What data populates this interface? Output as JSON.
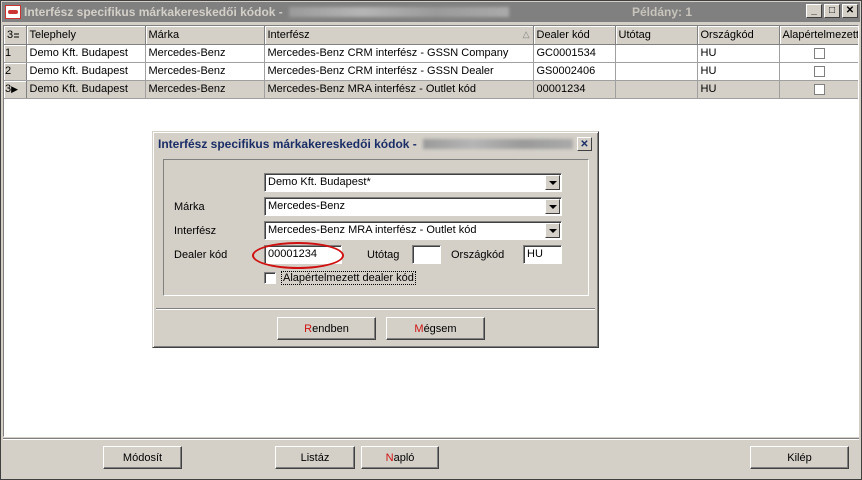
{
  "window": {
    "title": "Interfész specifikus márkakereskedői kódok -",
    "count_label": "Példány: 1",
    "controls": {
      "minimize": "_",
      "maximize": "□",
      "close": "✕"
    }
  },
  "grid": {
    "corner_label": "3",
    "columns": [
      "Telephely",
      "Márka",
      "Interfész",
      "Dealer kód",
      "Utótag",
      "Országkód",
      "Alapértelmezett d"
    ],
    "rows": [
      {
        "num": "1",
        "telephely": "Demo Kft. Budapest",
        "marka": "Mercedes-Benz",
        "interfesz": "Mercedes-Benz CRM interfész - GSSN Company",
        "dealer_kod": "GC0001534",
        "utotag": "",
        "orszagkod": "HU",
        "alapertelmezett": false
      },
      {
        "num": "2",
        "telephely": "Demo Kft. Budapest",
        "marka": "Mercedes-Benz",
        "interfesz": "Mercedes-Benz CRM interfész - GSSN Dealer",
        "dealer_kod": "GS0002406",
        "utotag": "",
        "orszagkod": "HU",
        "alapertelmezett": false
      },
      {
        "num": "3",
        "telephely": "Demo Kft. Budapest",
        "marka": "Mercedes-Benz",
        "interfesz": "Mercedes-Benz MRA interfész - Outlet kód",
        "dealer_kod": "00001234",
        "utotag": "",
        "orszagkod": "HU",
        "alapertelmezett": false,
        "selected": true
      }
    ]
  },
  "dialog": {
    "title": "Interfész specifikus márkakereskedői kódok -",
    "close": "✕",
    "telephely_value": "Demo Kft. Budapest*",
    "marka_label": "Márka",
    "marka_value": "Mercedes-Benz",
    "interfesz_label": "Interfész",
    "interfesz_value": "Mercedes-Benz MRA interfész - Outlet kód",
    "dealer_kod_label": "Dealer kód",
    "dealer_kod_value": "00001234",
    "utotag_label": "Utótag",
    "utotag_value": "",
    "orszagkod_label": "Országkód",
    "orszagkod_value": "HU",
    "default_checkbox_label": "Alapértelmezett dealer kód",
    "ok_accel": "R",
    "ok_rest": "endben",
    "cancel_accel": "M",
    "cancel_rest": "égsem"
  },
  "footer": {
    "modify_label": "Módosít",
    "list_label": "Listáz",
    "log_accel": "N",
    "log_rest": "apló",
    "exit_label": "Kilép"
  },
  "colors": {
    "highlight_oval": "#d01010",
    "accelerator": "#d01010"
  }
}
